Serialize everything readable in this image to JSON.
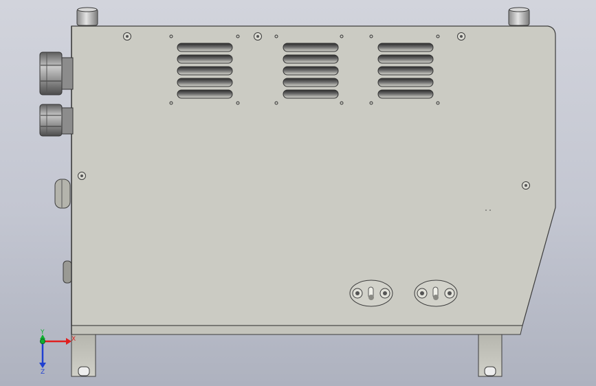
{
  "viewport": {
    "background_top": "#d2d4dc",
    "background_bottom": "#aeb2bf"
  },
  "model": {
    "view": "front",
    "panel_color": "#cbcbc3",
    "edge_color": "#3c3c3c",
    "vent_groups": 3,
    "slots_per_vent": 5,
    "cable_glands": 2,
    "connectors": 2,
    "mounting_feet": 2
  },
  "triad": {
    "x_label": "X",
    "y_label": "Y",
    "z_label": "Z",
    "x_color": "#e02020",
    "y_color": "#10b030",
    "z_color": "#2040d0"
  }
}
